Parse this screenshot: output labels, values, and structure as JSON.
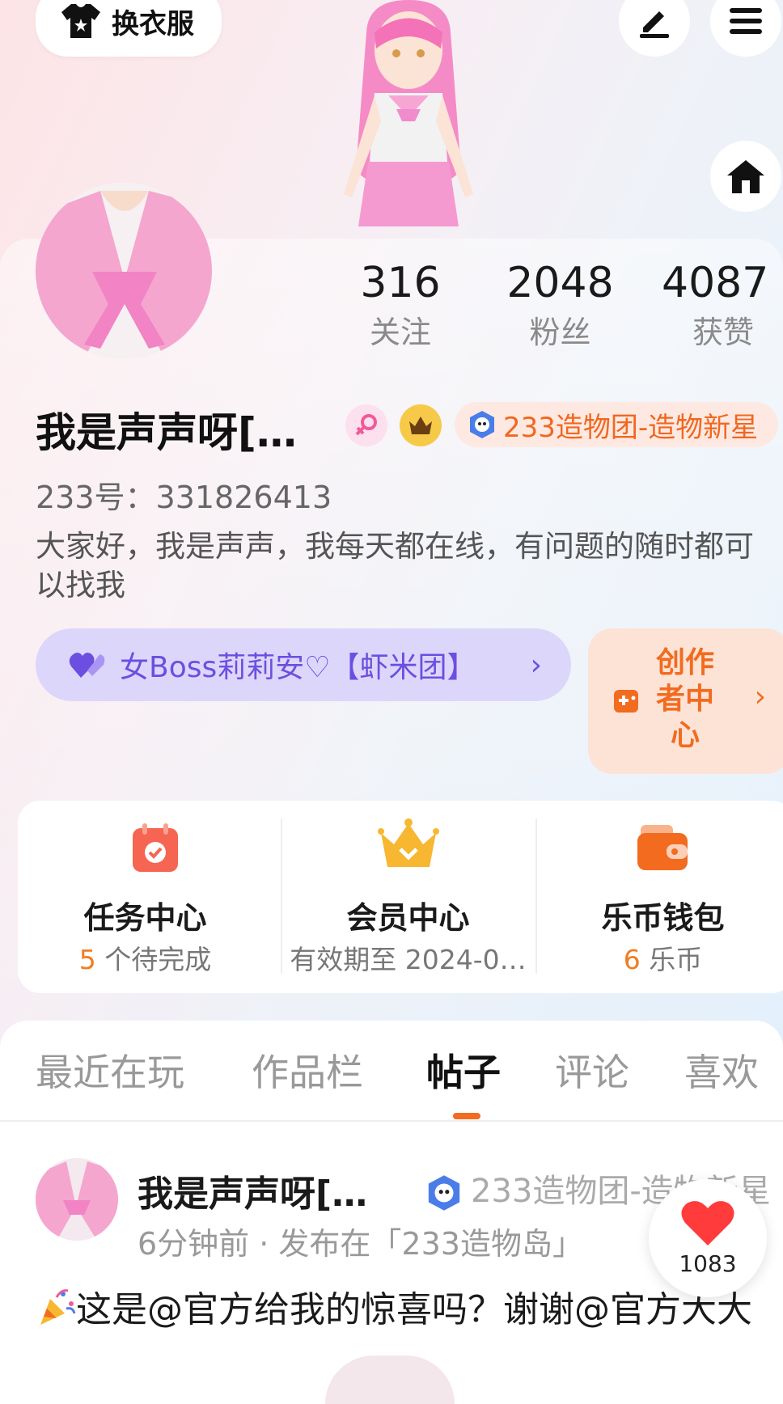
{
  "top": {
    "change_clothes_label": "换衣服"
  },
  "stats": [
    {
      "value": "316",
      "label": "关注"
    },
    {
      "value": "2048",
      "label": "粉丝"
    },
    {
      "value": "4087",
      "label": "获赞"
    }
  ],
  "profile": {
    "name": "我是声声呀[…",
    "title_badge": "233造物团-造物新星",
    "uid": "233号：331826413",
    "bio": "大家好，我是声声，我每天都在线，有问题的随时都可以找我",
    "family_label": "女Boss莉莉安♡【虾米团】",
    "creator_label": "创作者中心"
  },
  "services": [
    {
      "title": "任务中心",
      "sub_num": "5",
      "sub_text": " 个待完成"
    },
    {
      "title": "会员中心",
      "sub_num": "",
      "sub_text": "有效期至 2024-0…"
    },
    {
      "title": "乐币钱包",
      "sub_num": "6",
      "sub_text": " 乐币"
    }
  ],
  "tabs": [
    "最近在玩",
    "作品栏",
    "帖子",
    "评论",
    "喜欢"
  ],
  "active_tab": "帖子",
  "post": {
    "author": "我是声声呀[…",
    "author_badge": "233造物团-造物新星",
    "meta": "6分钟前 · 发布在「233造物岛」",
    "text": "这是@官方给我的惊喜吗？谢谢@官方大大",
    "likes": "1083"
  },
  "colors": {
    "accent": "#f26b1f",
    "family": "#6c4fe0",
    "like": "#ff3b3b"
  }
}
